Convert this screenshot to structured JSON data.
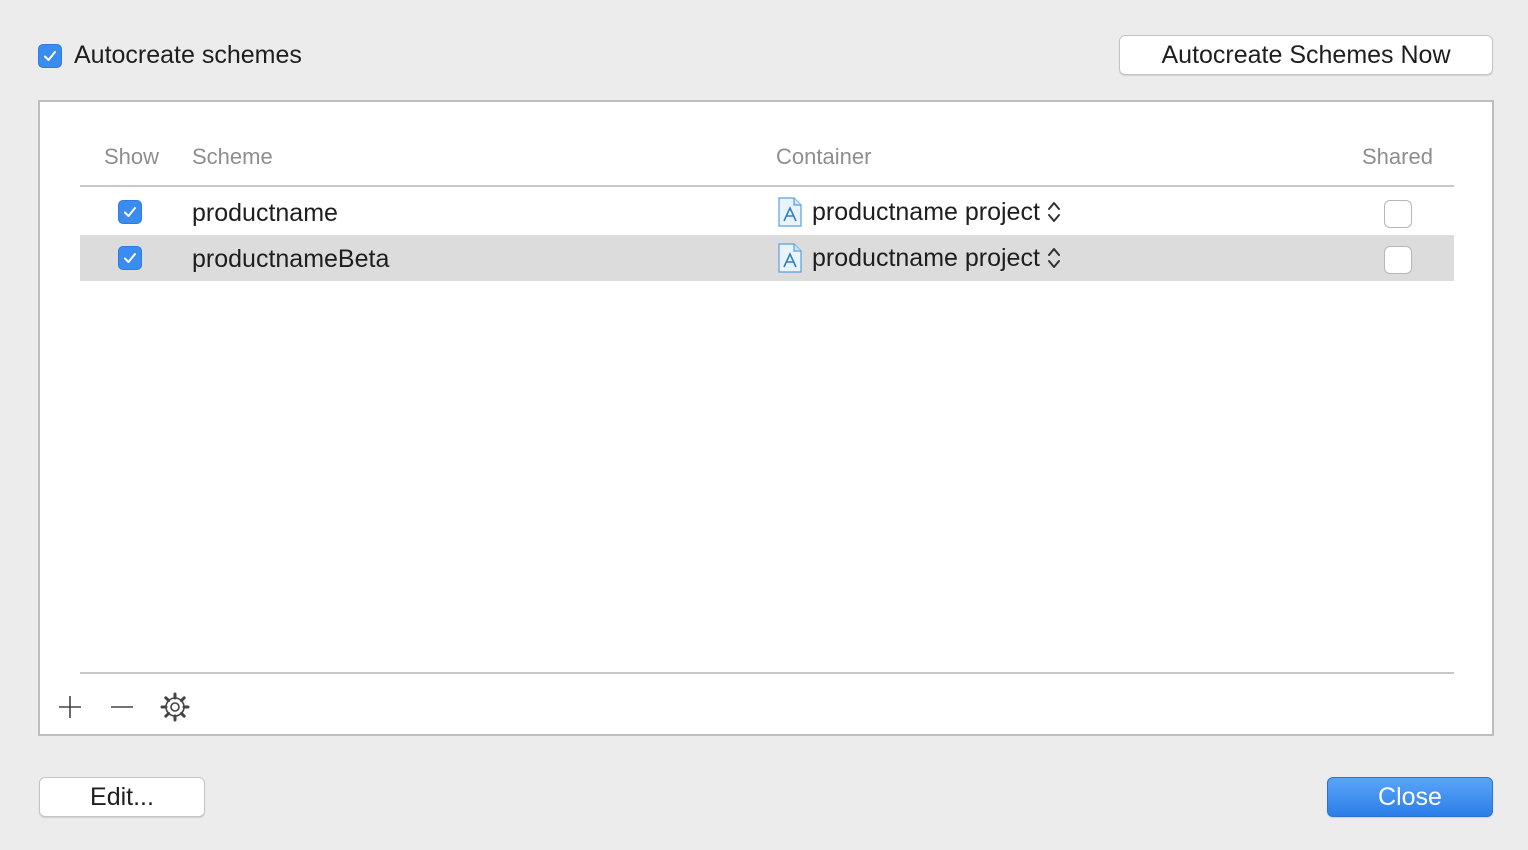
{
  "autocreate": {
    "label": "Autocreate schemes",
    "checked": true
  },
  "autocreate_now_button": "Autocreate Schemes Now",
  "table": {
    "headers": {
      "show": "Show",
      "scheme": "Scheme",
      "container": "Container",
      "shared": "Shared"
    },
    "rows": [
      {
        "show": true,
        "scheme": "productname",
        "container": "productname project",
        "shared": false
      },
      {
        "show": true,
        "scheme": "productnameBeta",
        "container": "productname project",
        "shared": false
      }
    ]
  },
  "toolbar": {
    "add_icon": "plus-icon",
    "remove_icon": "minus-icon",
    "settings_icon": "gear-icon"
  },
  "edit_button": "Edit...",
  "close_button": "Close",
  "colors": {
    "accent": "#3b8cf0",
    "background": "#ececec",
    "selected_row": "#dcdcdc"
  }
}
